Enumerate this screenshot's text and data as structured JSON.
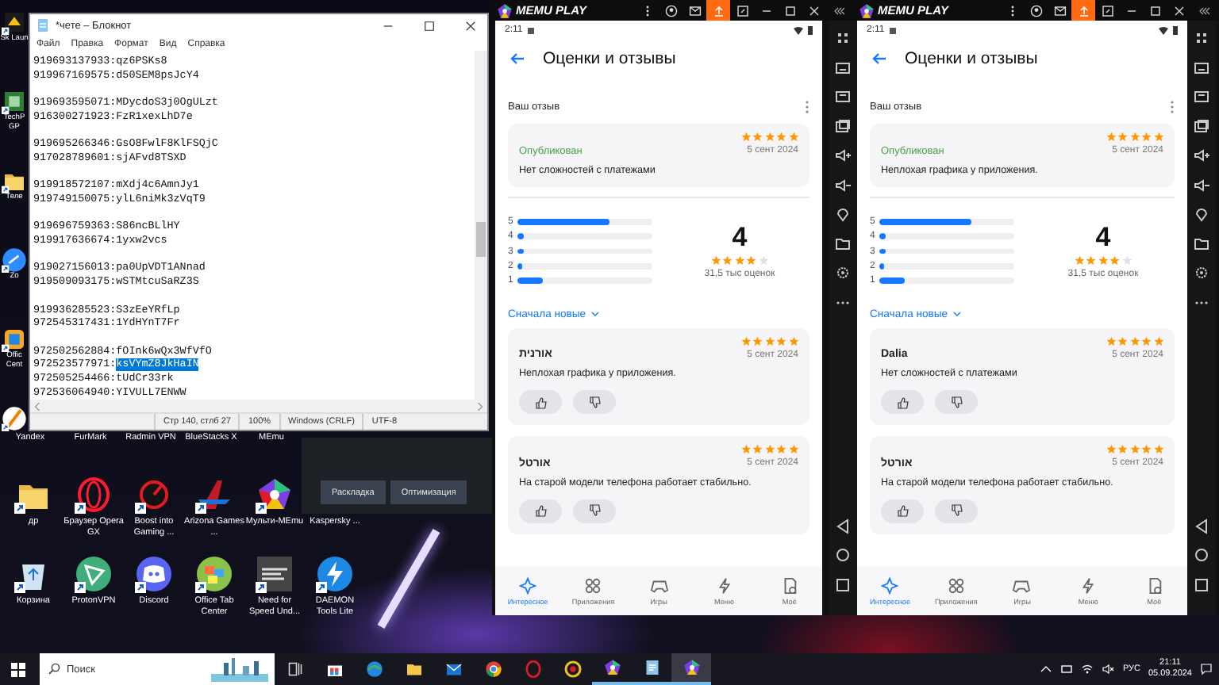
{
  "desktop": {
    "side_icons": [
      {
        "kind": "sk",
        "label": "Sk Laun"
      },
      {
        "kind": "techpo",
        "label": "TechP GP"
      },
      {
        "kind": "folder",
        "label": "Теле"
      },
      {
        "kind": "zoom",
        "label": "Zo"
      },
      {
        "kind": "office",
        "label": "Offic Cent"
      },
      {
        "kind": "orange"
      }
    ],
    "label_row": [
      "Yandex",
      "FurMark",
      "Radmin VPN",
      "BlueStacks X",
      "MEmu"
    ],
    "row_1": [
      {
        "kind": "folder",
        "label": "др"
      },
      {
        "kind": "opera",
        "label": "Браузер Opera GX"
      },
      {
        "kind": "gauge",
        "label": "Boost into Gaming ..."
      },
      {
        "kind": "arizona",
        "label": "Arizona Games ..."
      },
      {
        "kind": "pentagon",
        "label": "Мульти-MEmu"
      },
      {
        "kind": "hidden",
        "label": "Kaspersky ..."
      }
    ],
    "row_2": [
      {
        "kind": "recycle",
        "label": "Корзина"
      },
      {
        "kind": "proton",
        "label": "ProtonVPN"
      },
      {
        "kind": "discord",
        "label": "Discord"
      },
      {
        "kind": "officetab",
        "label": "Office Tab Center"
      },
      {
        "kind": "nfs",
        "label": "Need for Speed Und..."
      },
      {
        "kind": "daemon",
        "label": "DAEMON Tools Lite"
      }
    ],
    "panel_buttons": [
      "Раскладка",
      "Оптимизация"
    ]
  },
  "notepad": {
    "title": "*чете – Блокнот",
    "menu": [
      "Файл",
      "Правка",
      "Формат",
      "Вид",
      "Справка"
    ],
    "paragraphs": [
      [
        {
          "text": "919693137933:qz6PSKs8"
        },
        {
          "text": "919967169575:d50SEM8psJcY4"
        }
      ],
      [
        {
          "text": "919693595071:MDycdoS3j0OgULzt"
        },
        {
          "text": "916300271923:FzR1xexLhD7e"
        }
      ],
      [
        {
          "text": "919695266346:GsO8FwlF8KlFSQjC"
        },
        {
          "text": "917028789601:sjAFvd8TSXD"
        }
      ],
      [
        {
          "text": "919918572107:mXdj4c6AmnJy1"
        },
        {
          "text": "919749150075:ylL6niMk3zVqT9"
        }
      ],
      [
        {
          "text": "919696759363:S86ncBLlHY"
        },
        {
          "text": "919917636674:1yxw2vcs"
        }
      ],
      [
        {
          "text": "919027156013:pa0UpVDT1ANnad"
        },
        {
          "text": "919509093175:wSTMtcuSaRZ3S"
        }
      ],
      [
        {
          "text": "919936285523:S3zEeYRfLp"
        },
        {
          "text": "972545317431:1YdHYnT7Fr"
        }
      ],
      [
        {
          "text": "972502562884:fOInk6wQx3WfVfO"
        },
        {
          "text": "972523577971:",
          "selection": "ksVYmZ8JkHaIN"
        },
        {
          "text": "972505254466:tUdCr33rk"
        },
        {
          "text": "972536064940:YIVULL7ENWW"
        }
      ]
    ],
    "status": [
      "Стр 140, стлб 27",
      "100%",
      "Windows (CRLF)",
      "UTF-8"
    ]
  },
  "emulators": [
    {
      "brand": "MEMU PLAY",
      "time": "2:11",
      "title": "Оценки и отзывы",
      "my_review_heading": "Ваш отзыв",
      "my_review": {
        "stars": 5,
        "status": "Опубликован",
        "date": "5 сент 2024",
        "text": "Нет сложностей с платежами"
      },
      "histogram": [
        {
          "label": "5",
          "level": 0.68
        },
        {
          "label": "4",
          "level": 0.04
        },
        {
          "label": "3",
          "level": 0.04
        },
        {
          "label": "2",
          "level": 0.03
        },
        {
          "label": "1",
          "level": 0.19
        }
      ],
      "average": {
        "value": "4",
        "stars": 4
      },
      "count": "31,5 тыс оценок",
      "sort": "Сначала новые",
      "reviews": [
        {
          "author": "אורנית",
          "stars": 5,
          "date": "5 сент 2024",
          "text": "Неплохая графика у приложения."
        },
        {
          "author": "אורטל",
          "stars": 5,
          "date": "5 сент 2024",
          "text": "На старой модели телефона работает стабильно."
        }
      ],
      "nav": [
        {
          "kind": "sparkle",
          "label": "Интересное",
          "selected": true
        },
        {
          "kind": "apps",
          "label": "Приложения",
          "selected": false
        },
        {
          "kind": "gamepad",
          "label": "Игры",
          "selected": false
        },
        {
          "kind": "bolt",
          "label": "Меню",
          "selected": false
        },
        {
          "kind": "mine",
          "label": "Моё",
          "selected": false
        }
      ]
    },
    {
      "brand": "MEMU PLAY",
      "time": "2:11",
      "title": "Оценки и отзывы",
      "my_review_heading": "Ваш отзыв",
      "toolbars": true,
      "my_review": {
        "stars": 5,
        "status": "Опубликован",
        "date": "5 сент 2024",
        "text": "Неплохая графика у приложения."
      },
      "histogram": [
        {
          "label": "5",
          "level": 0.68
        },
        {
          "label": "4",
          "level": 0.04
        },
        {
          "label": "3",
          "level": 0.04
        },
        {
          "label": "2",
          "level": 0.03
        },
        {
          "label": "1",
          "level": 0.19
        }
      ],
      "average": {
        "value": "4",
        "stars": 4
      },
      "count": "31,5 тыс оценок",
      "sort": "Сначала новые",
      "reviews": [
        {
          "author": "Dalia",
          "stars": 5,
          "date": "5 сент 2024",
          "text": "Нет сложностей с платежами"
        },
        {
          "author": "אורטל",
          "stars": 5,
          "date": "5 сент 2024",
          "text": "На старой модели телефона работает стабильно."
        }
      ],
      "nav": [
        {
          "kind": "sparkle",
          "label": "Интересное",
          "selected": true
        },
        {
          "kind": "apps",
          "label": "Приложения",
          "selected": false
        },
        {
          "kind": "gamepad",
          "label": "Игры",
          "selected": false
        },
        {
          "kind": "bolt",
          "label": "Меню",
          "selected": false
        },
        {
          "kind": "mine",
          "label": "Моё",
          "selected": false
        }
      ]
    }
  ],
  "taskbar": {
    "placeholder": "Поиск",
    "apps": [
      {
        "kind": "taskview",
        "running": false,
        "selected": false
      },
      {
        "kind": "store",
        "running": false,
        "selected": false
      },
      {
        "kind": "edge",
        "running": false,
        "selected": false
      },
      {
        "kind": "explorer",
        "running": false,
        "selected": false
      },
      {
        "kind": "mail",
        "running": false,
        "selected": false
      },
      {
        "kind": "chrome",
        "running": false,
        "selected": false
      },
      {
        "kind": "opera",
        "running": false,
        "selected": false
      },
      {
        "kind": "ring",
        "running": false,
        "selected": false
      },
      {
        "kind": "pentagon",
        "running": true,
        "selected": false
      },
      {
        "kind": "notepad",
        "running": true,
        "selected": false
      },
      {
        "kind": "pentagon",
        "running": true,
        "selected": true
      }
    ],
    "language": "РУС",
    "time": "21:11",
    "date": "05.09.2024"
  }
}
